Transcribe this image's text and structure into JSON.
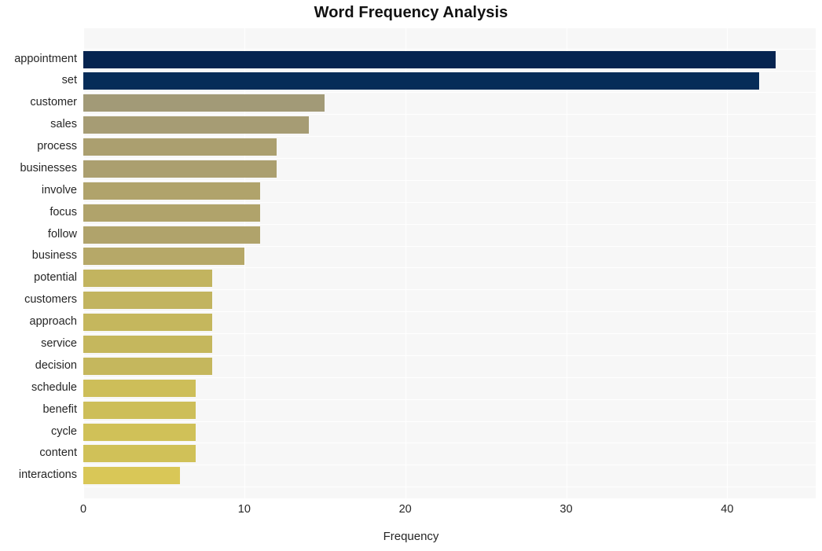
{
  "chart_data": {
    "type": "bar",
    "orientation": "horizontal",
    "title": "Word Frequency Analysis",
    "xlabel": "Frequency",
    "ylabel": "",
    "xlim": [
      0,
      45.5
    ],
    "xticks": [
      0,
      10,
      20,
      30,
      40
    ],
    "xtick_labels": [
      "0",
      "10",
      "20",
      "30",
      "40"
    ],
    "grid": true,
    "grid_color": "#ffffff",
    "plot_background": "#f7f7f7",
    "figure_background": "#ffffff",
    "legend": null,
    "categories": [
      "appointment",
      "set",
      "customer",
      "sales",
      "process",
      "businesses",
      "involve",
      "focus",
      "follow",
      "business",
      "potential",
      "customers",
      "approach",
      "service",
      "decision",
      "schedule",
      "benefit",
      "cycle",
      "content",
      "interactions"
    ],
    "values": [
      43,
      42,
      15,
      14,
      12,
      12,
      11,
      11,
      11,
      10,
      8,
      8,
      8,
      8,
      8,
      7,
      7,
      7,
      7,
      6
    ],
    "bar_colors": [
      "#062450",
      "#062c58",
      "#a29a77",
      "#a69c74",
      "#ab9f6f",
      "#ab9f6f",
      "#b0a36b",
      "#b0a36b",
      "#b0a36b",
      "#b6a868",
      "#c2b45f",
      "#c2b45f",
      "#c5b75d",
      "#c5b75d",
      "#c5b75d",
      "#cdbe59",
      "#cdbe59",
      "#d0c158",
      "#d0c158",
      "#d9c757"
    ]
  },
  "title": {
    "text": "Word Frequency Analysis"
  },
  "axes": {
    "x_axis_title": "Frequency"
  }
}
